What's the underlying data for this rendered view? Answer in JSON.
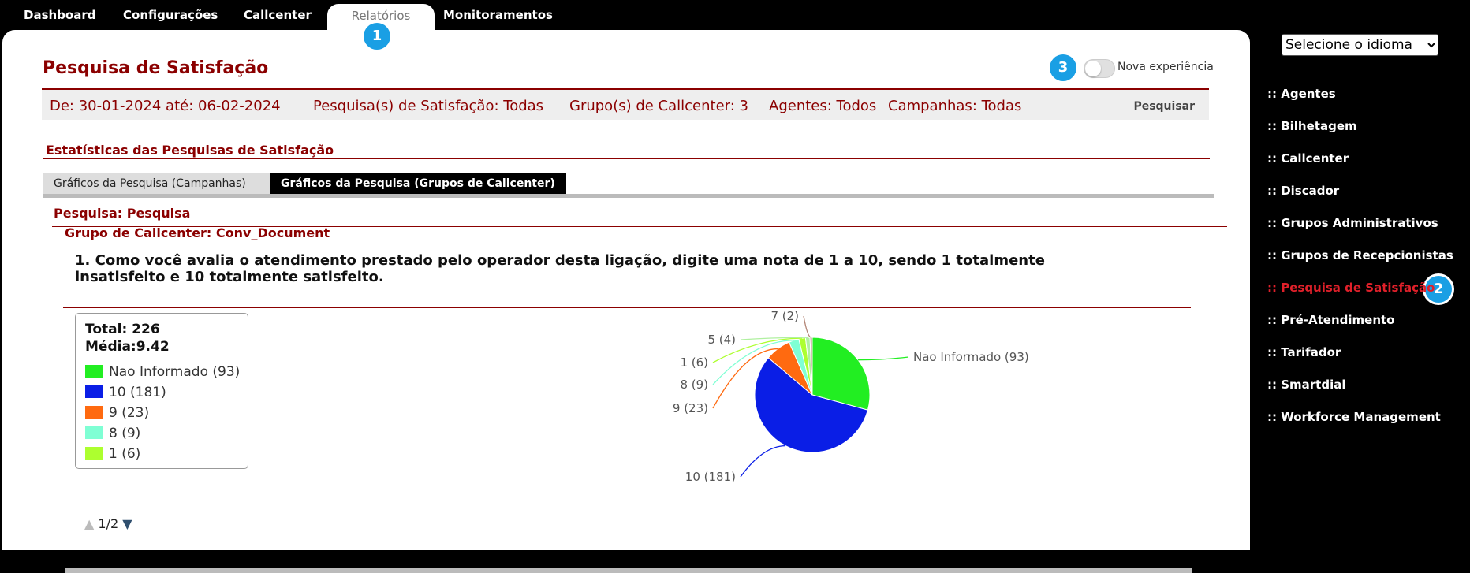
{
  "nav": {
    "tabs": [
      {
        "label": "Dashboard"
      },
      {
        "label": "Configurações"
      },
      {
        "label": "Callcenter"
      },
      {
        "label": "Relatórios"
      },
      {
        "label": "Monitoramentos"
      }
    ],
    "active": "Relatórios"
  },
  "badges": [
    "1",
    "2",
    "3"
  ],
  "page": {
    "title": "Pesquisa de Satisfação",
    "toggle_label": "Nova experiência",
    "toggle_on": false
  },
  "filters": {
    "date": "De: 30-01-2024 até: 06-02-2024",
    "surveys": "Pesquisa(s) de Satisfação: Todas",
    "groups": "Grupo(s) de Callcenter: 3",
    "agents": "Agentes: Todos",
    "campaigns": "Campanhas: Todas",
    "search_label": "Pesquisar"
  },
  "stats": {
    "section_title": "Estatísticas das Pesquisas de Satisfação",
    "tabs": [
      {
        "label": "Gráficos da Pesquisa (Campanhas)"
      },
      {
        "label": "Gráficos da Pesquisa (Grupos de Callcenter)"
      }
    ],
    "survey_heading": "Pesquisa: Pesquisa",
    "group_heading": "Grupo de Callcenter: Conv_Document",
    "question": "1. Como você avalia o atendimento prestado pelo operador desta ligação, digite uma nota de 1 a 10, sendo 1 totalmente insatisfeito e 10 totalmente satisfeito."
  },
  "legend": {
    "total": "Total: 226",
    "media": "Média:9.42",
    "items": [
      {
        "label": "Nao Informado (93)",
        "color": "#22ee22"
      },
      {
        "label": "10 (181)",
        "color": "#0a1ee6"
      },
      {
        "label": "9 (23)",
        "color": "#ff6a10"
      },
      {
        "label": "8 (9)",
        "color": "#7fffd4"
      },
      {
        "label": "1 (6)",
        "color": "#adff2f"
      }
    ],
    "pager": "1/2"
  },
  "chart_data": {
    "type": "pie",
    "slices": [
      {
        "label": "Nao Informado (93)",
        "value": 93,
        "color": "#22ee22"
      },
      {
        "label": "10 (181)",
        "value": 181,
        "color": "#0a1ee6"
      },
      {
        "label": "9 (23)",
        "value": 23,
        "color": "#ff6a10"
      },
      {
        "label": "8 (9)",
        "value": 9,
        "color": "#7fffd4"
      },
      {
        "label": "1 (6)",
        "value": 6,
        "color": "#adff2f"
      },
      {
        "label": "5 (4)",
        "value": 4,
        "color": "#b0f0a0"
      },
      {
        "label": "7 (2)",
        "value": 2,
        "color": "#b08070"
      }
    ]
  },
  "sidebar": {
    "language_placeholder": "Selecione o idioma",
    "items": [
      {
        "label": ":: Agentes"
      },
      {
        "label": ":: Bilhetagem"
      },
      {
        "label": ":: Callcenter"
      },
      {
        "label": ":: Discador"
      },
      {
        "label": ":: Grupos Administrativos"
      },
      {
        "label": ":: Grupos de Recepcionistas"
      },
      {
        "label": ":: Pesquisa de Satisfação"
      },
      {
        "label": ":: Pré-Atendimento"
      },
      {
        "label": ":: Tarifador"
      },
      {
        "label": ":: Smartdial"
      },
      {
        "label": ":: Workforce Management"
      }
    ],
    "active": ":: Pesquisa de Satisfação"
  }
}
